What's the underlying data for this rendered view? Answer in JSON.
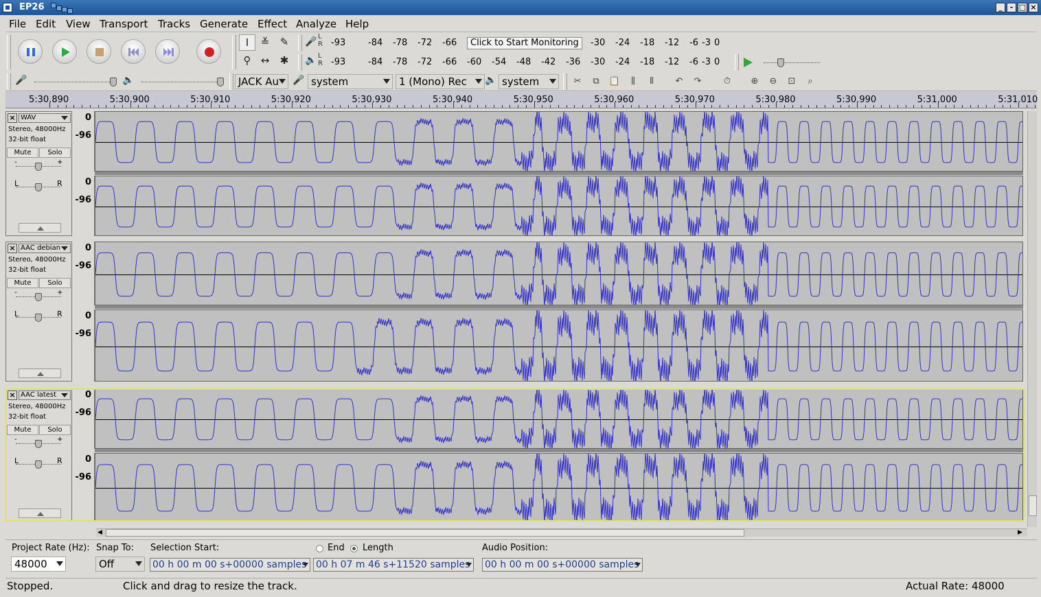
{
  "window": {
    "title": "EP26"
  },
  "menu": [
    "File",
    "Edit",
    "View",
    "Transport",
    "Tracks",
    "Generate",
    "Effect",
    "Analyze",
    "Help"
  ],
  "meters": {
    "record_scale": [
      "-93",
      "-84",
      "-78",
      "-72",
      "-66",
      "-30",
      "-24",
      "-18",
      "-12",
      "-6",
      "-3",
      "0"
    ],
    "monitor_label": "Click to Start Monitoring",
    "play_scale": [
      "-93",
      "-84",
      "-78",
      "-72",
      "-66",
      "-60",
      "-54",
      "-48",
      "-42",
      "-36",
      "-30",
      "-24",
      "-18",
      "-12",
      "-6",
      "-3",
      "0"
    ],
    "lr": "L R"
  },
  "devices": {
    "host": "JACK Au",
    "recording_device": "system",
    "channels": "1 (Mono) Rec",
    "playback_device": "system"
  },
  "ruler": {
    "labels": [
      "5:30.890",
      "5:30.900",
      "5:30.910",
      "5:30.920",
      "5:30.930",
      "5:30.940",
      "5:30.950",
      "5:30.960",
      "5:30.970",
      "5:30.980",
      "5:30.990",
      "5:31.000",
      "5:31.010"
    ]
  },
  "tracks": [
    {
      "name": "WAV",
      "info1": "Stereo, 48000Hz",
      "info2": "32-bit float",
      "mute": "Mute",
      "solo": "Solo",
      "vtop": "0",
      "vbottom": "-96",
      "selected": false
    },
    {
      "name": "AAC debian",
      "info1": "Stereo, 48000Hz",
      "info2": "32-bit float",
      "mute": "Mute",
      "solo": "Solo",
      "vtop": "0",
      "vbottom": "-96",
      "selected": false
    },
    {
      "name": "AAC latest",
      "info1": "Stereo, 48000Hz",
      "info2": "32-bit float",
      "mute": "Mute",
      "solo": "Solo",
      "vtop": "0",
      "vbottom": "-96",
      "selected": true
    }
  ],
  "gain_labels": {
    "minus": "-",
    "plus": "+",
    "left": "L",
    "right": "R"
  },
  "selection_bar": {
    "project_rate_label": "Project Rate (Hz):",
    "project_rate": "48000",
    "snap_to_label": "Snap To:",
    "snap_to": "Off",
    "selection_start_label": "Selection Start:",
    "selection_start": "00 h 00 m 00 s+00000 samples",
    "end_label": "End",
    "length_label": "Length",
    "length_selected": true,
    "length": "00 h 07 m 46 s+11520 samples",
    "audio_position_label": "Audio Position:",
    "audio_position": "00 h 00 m 00 s+00000 samples"
  },
  "status": {
    "state": "Stopped.",
    "hint": "Click and drag to resize the track.",
    "rate": "Actual Rate: 48000"
  },
  "colors": {
    "waveform": "#3232c8",
    "wave_bg": "#c0c0c0",
    "selected_outline": "#e0e070",
    "titlebar": "#1f5595"
  }
}
